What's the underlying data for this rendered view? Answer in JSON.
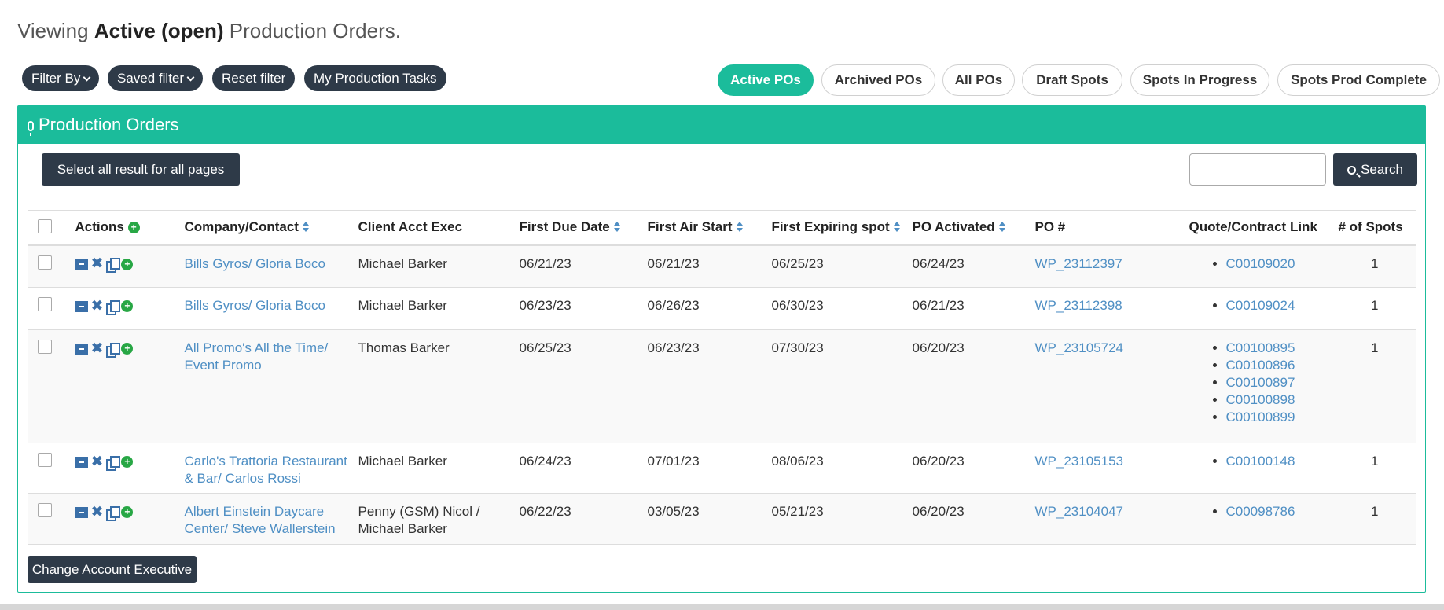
{
  "heading": {
    "prefix": "Viewing",
    "bold": "Active (open)",
    "suffix": "Production Orders."
  },
  "filters": {
    "filter_by": "Filter By",
    "saved_filter": "Saved filter",
    "reset_filter": "Reset filter",
    "my_tasks": "My Production Tasks"
  },
  "tabs": [
    {
      "label": "Active POs",
      "active": true
    },
    {
      "label": "Archived POs",
      "active": false
    },
    {
      "label": "All POs",
      "active": false
    },
    {
      "label": "Draft Spots",
      "active": false
    },
    {
      "label": "Spots In Progress",
      "active": false
    },
    {
      "label": "Spots Prod Complete",
      "active": false
    }
  ],
  "panel": {
    "title": "Production Orders",
    "select_all_label": "Select all result for all pages",
    "search_label": "Search",
    "search_value": "",
    "change_ae_label": "Change Account Executive"
  },
  "columns": {
    "actions": "Actions",
    "company": "Company/Contact",
    "client_ae": "Client Acct Exec",
    "first_due": "First Due Date",
    "first_air": "First Air Start",
    "first_expiring": "First Expiring spot",
    "po_activated": "PO Activated",
    "po_number": "PO #",
    "quote_link": "Quote/Contract Link",
    "num_spots": "# of Spots"
  },
  "rows": [
    {
      "company": "Bills Gyros/ Gloria Boco",
      "client_ae": "Michael Barker",
      "first_due": "06/21/23",
      "first_air": "06/21/23",
      "first_expiring": "06/25/23",
      "po_activated": "06/24/23",
      "po_number": "WP_23112397",
      "quotes": [
        "C00109020"
      ],
      "num_spots": "1"
    },
    {
      "company": "Bills Gyros/ Gloria Boco",
      "client_ae": "Michael Barker",
      "first_due": "06/23/23",
      "first_air": "06/26/23",
      "first_expiring": "06/30/23",
      "po_activated": "06/21/23",
      "po_number": "WP_23112398",
      "quotes": [
        "C00109024"
      ],
      "num_spots": "1"
    },
    {
      "company": "All Promo's All the Time/ Event Promo",
      "client_ae": "Thomas Barker",
      "first_due": "06/25/23",
      "first_air": "06/23/23",
      "first_expiring": "07/30/23",
      "po_activated": "06/20/23",
      "po_number": "WP_23105724",
      "quotes": [
        "C00100895",
        "C00100896",
        "C00100897",
        "C00100898",
        "C00100899"
      ],
      "num_spots": "1"
    },
    {
      "company": "Carlo's Trattoria Restaurant & Bar/ Carlos Rossi",
      "client_ae": "Michael Barker",
      "first_due": "06/24/23",
      "first_air": "07/01/23",
      "first_expiring": "08/06/23",
      "po_activated": "06/20/23",
      "po_number": "WP_23105153",
      "quotes": [
        "C00100148"
      ],
      "num_spots": "1"
    },
    {
      "company": "Albert Einstein Daycare Center/ Steve Wallerstein",
      "client_ae": "Penny (GSM) Nicol / Michael Barker",
      "first_due": "06/22/23",
      "first_air": "03/05/23",
      "first_expiring": "05/21/23",
      "po_activated": "06/20/23",
      "po_number": "WP_23104047",
      "quotes": [
        "C00098786"
      ],
      "num_spots": "1"
    }
  ],
  "colors": {
    "accent": "#1bbc9b",
    "dark": "#2e3a48",
    "link": "#4f8fc4"
  }
}
